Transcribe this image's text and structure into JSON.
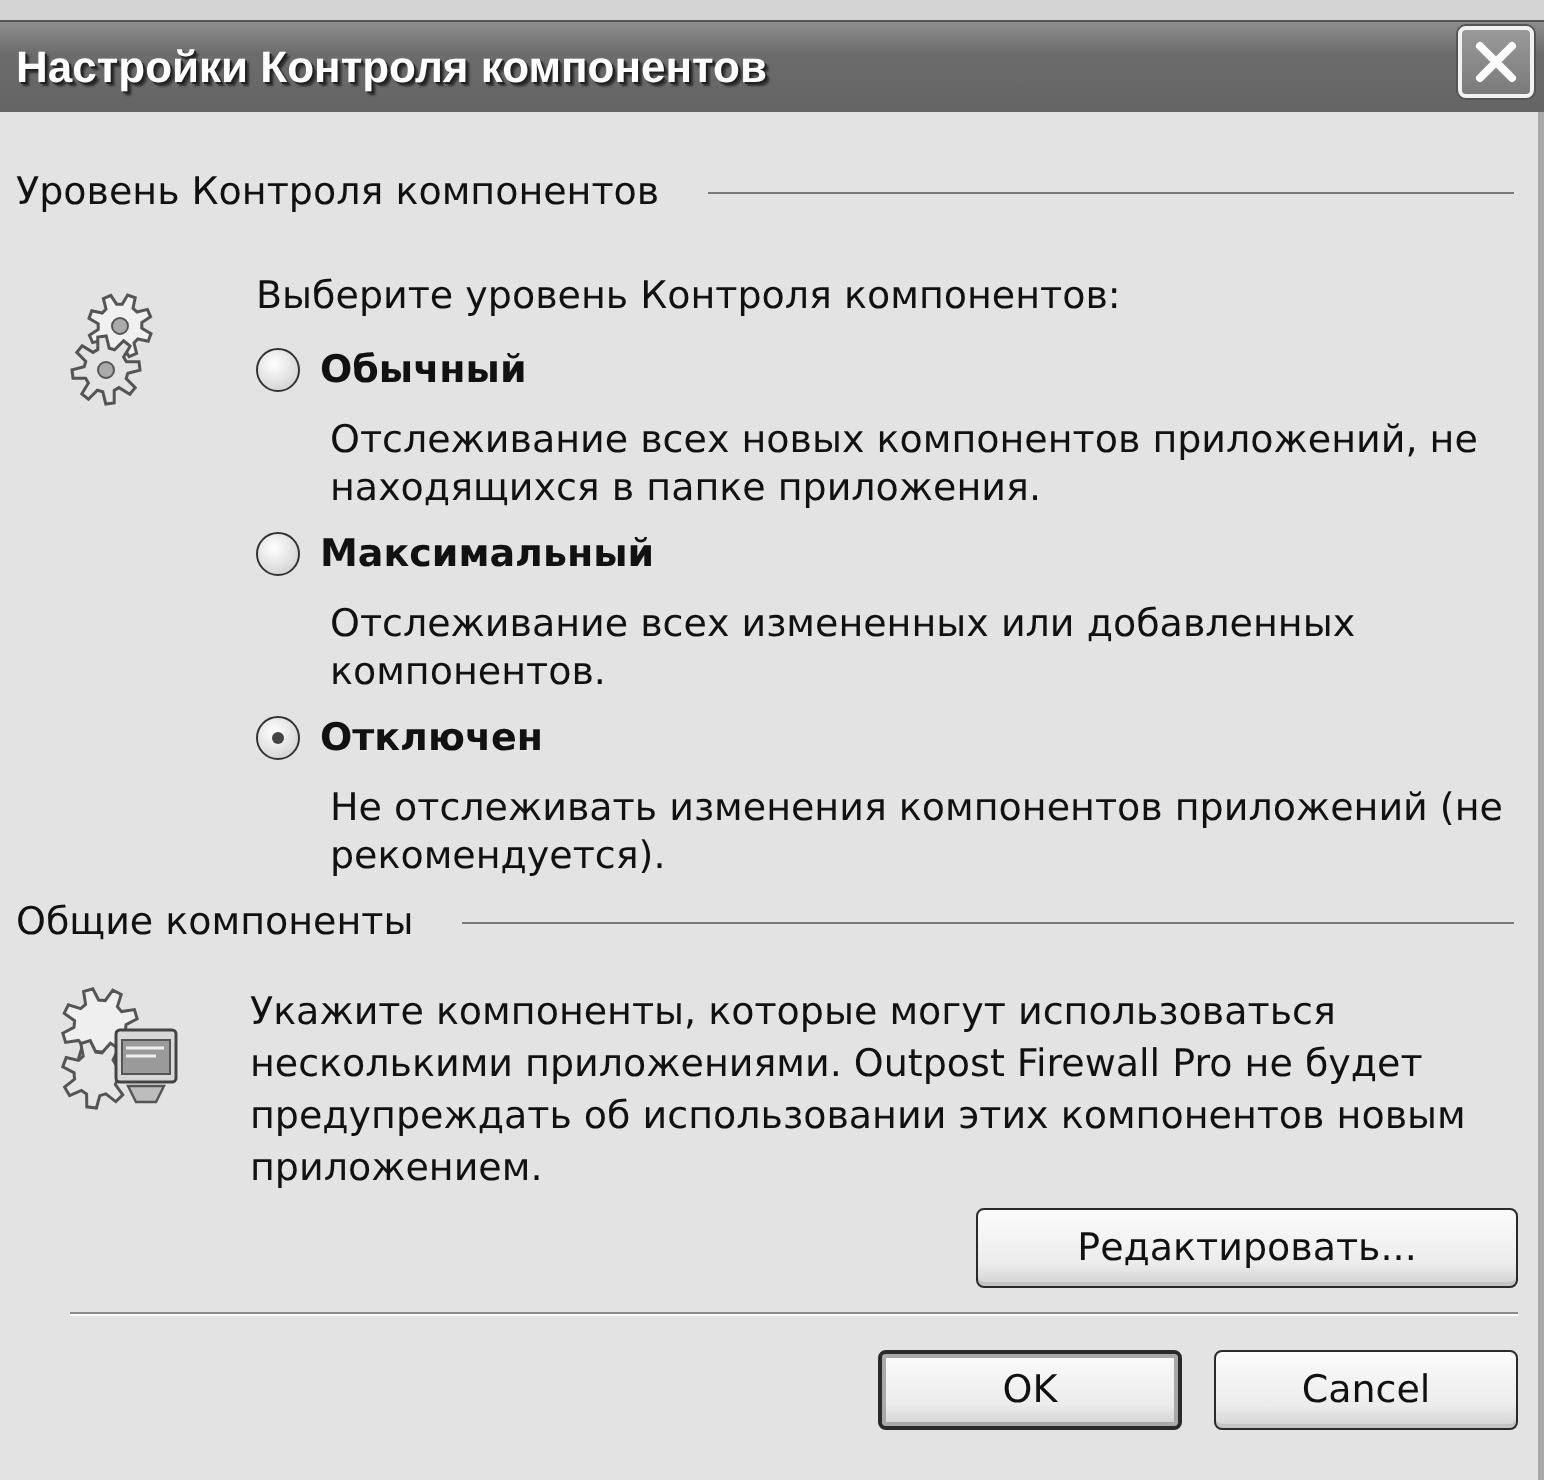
{
  "window": {
    "title": "Настройки Контроля компонентов"
  },
  "level_section": {
    "heading": "Уровень Контроля компонентов",
    "prompt": "Выберите уровень Контроля компонентов:",
    "options": [
      {
        "label": "Обычный",
        "description": "Отслеживание всех новых компонентов приложений, не находящихся в папке приложения.",
        "selected": false
      },
      {
        "label": "Максимальный",
        "description": "Отслеживание всех измененных или добавленных компонентов.",
        "selected": false
      },
      {
        "label": "Отключен",
        "description": "Не отслеживать изменения компонентов приложений (не рекомендуется).",
        "selected": true
      }
    ]
  },
  "shared_section": {
    "heading": "Общие компоненты",
    "description": "Укажите компоненты, которые могут использоваться несколькими приложениями. Outpost Firewall Pro не будет предупреждать об использовании этих компонентов новым приложением.",
    "button": "Редактировать..."
  },
  "buttons": [
    {
      "label": "OK",
      "default": true
    },
    {
      "label": "Cancel",
      "default": false
    }
  ]
}
